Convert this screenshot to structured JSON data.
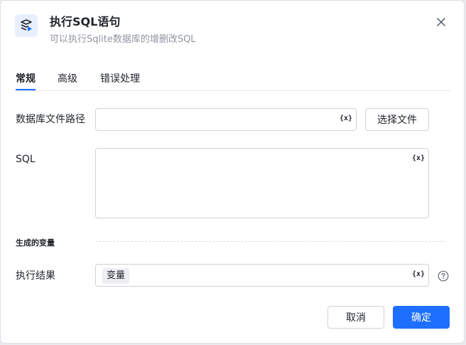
{
  "dialog": {
    "title": "执行SQL语句",
    "subtitle": "可以执行Sqlite数据库的增删改SQL",
    "icon": "sql-db-icon"
  },
  "tabs": [
    {
      "label": "常规",
      "active": true
    },
    {
      "label": "高级",
      "active": false
    },
    {
      "label": "错误处理",
      "active": false
    }
  ],
  "form": {
    "db_path": {
      "label": "数据库文件路径",
      "value": "",
      "var_button": "{x}",
      "select_button": "选择文件"
    },
    "sql": {
      "label": "SQL",
      "value": "",
      "var_button": "{x}"
    },
    "output_section": "生成的变量",
    "result": {
      "label": "执行结果",
      "tag": "变量",
      "var_button": "{x}",
      "help_icon": "help-circle-icon"
    }
  },
  "footer": {
    "cancel": "取消",
    "confirm": "确定"
  },
  "colors": {
    "primary": "#1e6fff",
    "text": "#1f2329",
    "muted": "#8f959e",
    "border": "#d0d3d6"
  }
}
